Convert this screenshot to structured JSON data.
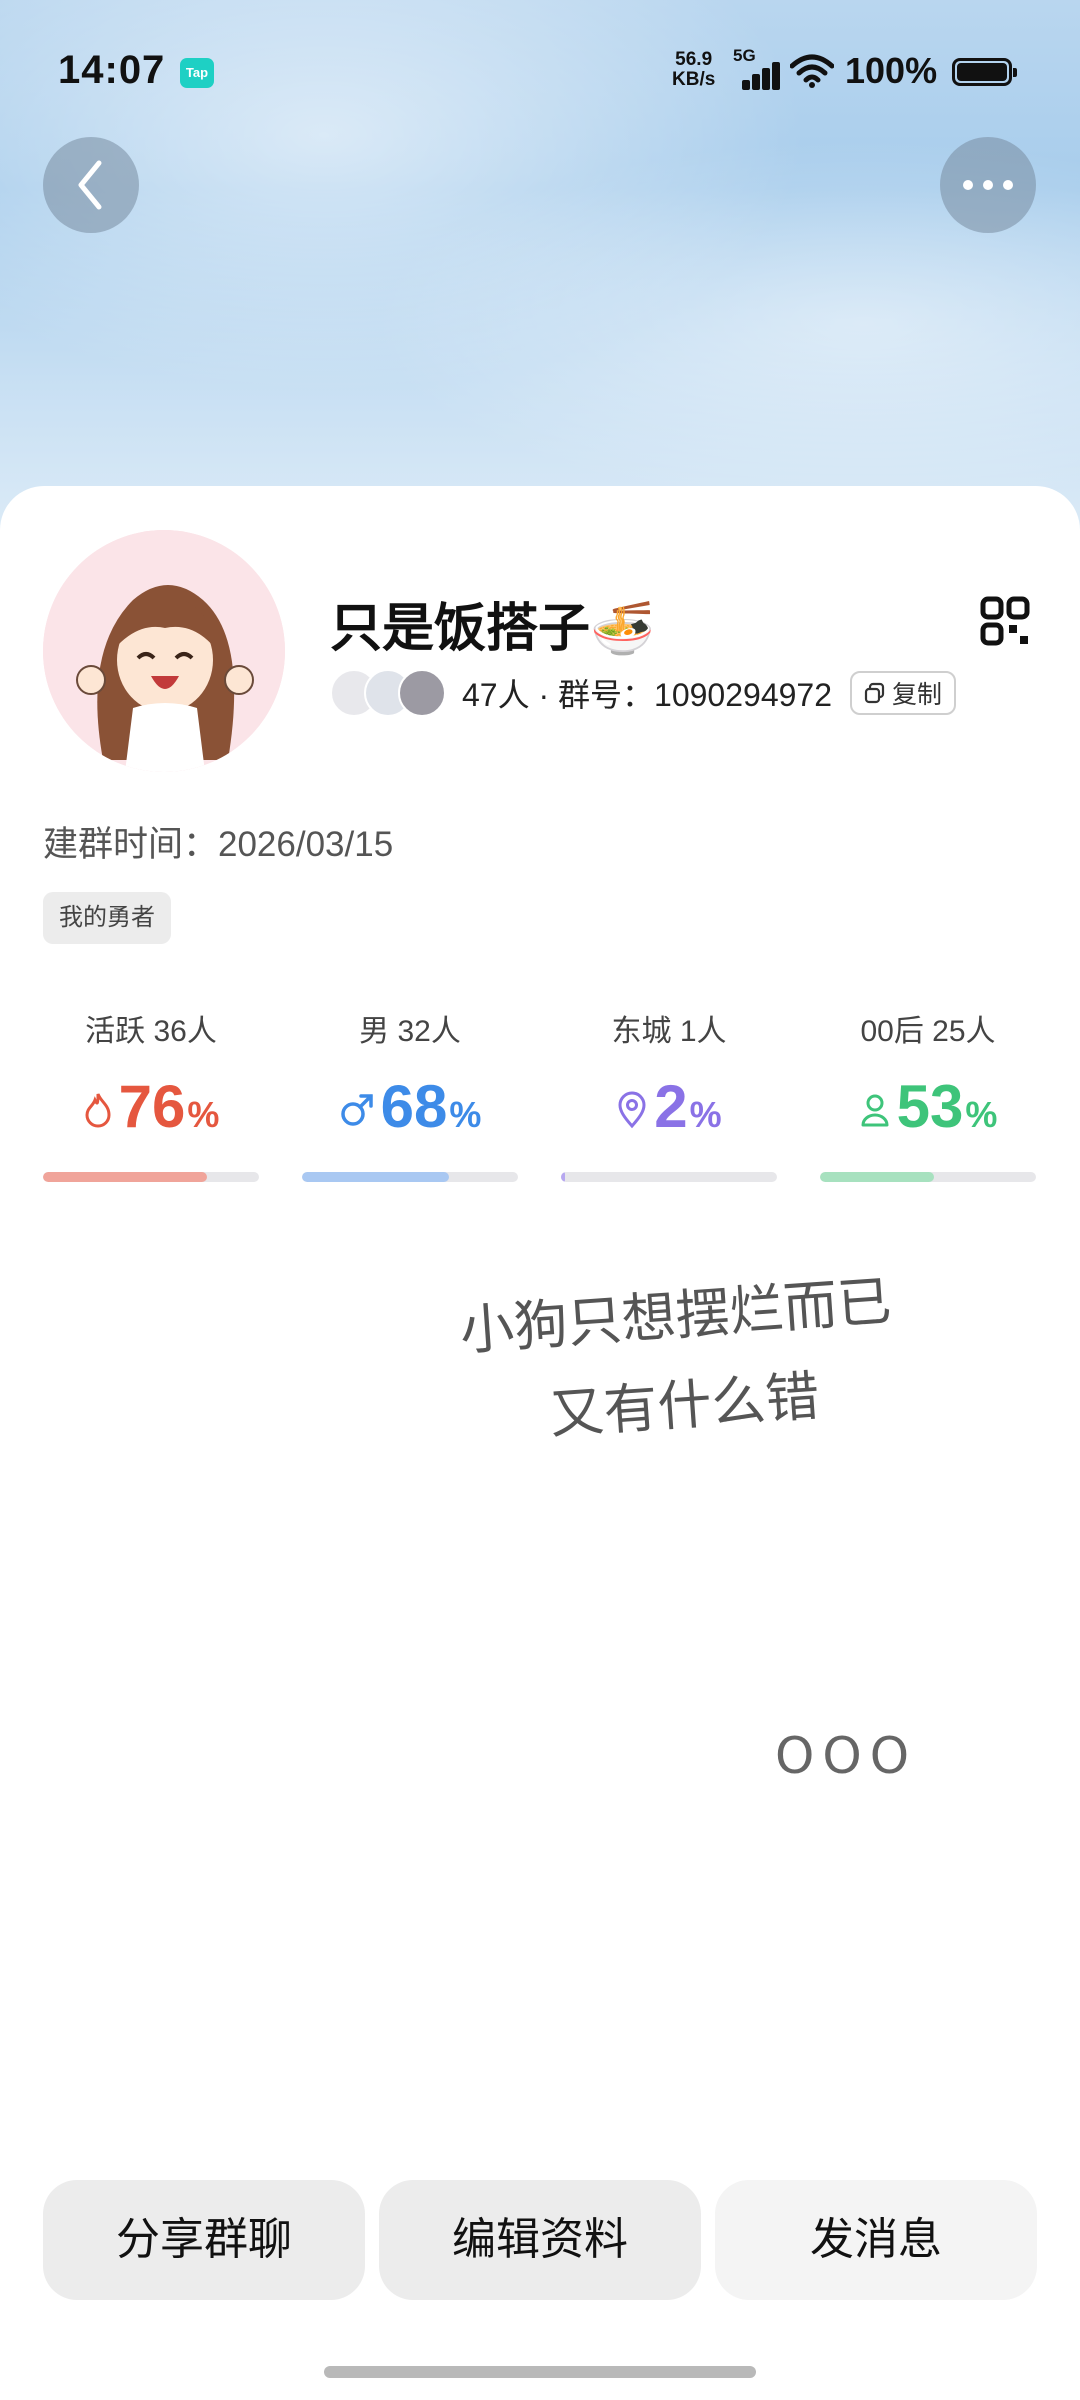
{
  "status_bar": {
    "time": "14:07",
    "app_badge": "Tap",
    "net_speed_value": "56.9",
    "net_speed_unit": "KB/s",
    "network": "5G",
    "battery": "100%"
  },
  "header": {
    "back_icon": "chevron-left-icon",
    "more_icon": "ellipsis-icon"
  },
  "group": {
    "name": "只是饭搭子🍜",
    "member_summary": "47人 · 群号：1090294972",
    "copy_label": "复制",
    "created": "建群时间：2026/03/15",
    "tag": "我的勇者"
  },
  "stats": [
    {
      "label": "活跃 36人",
      "value": "76",
      "unit": "%",
      "fraction": 0.76,
      "icon": "flame-icon",
      "color": "#e5573f",
      "bar_color": "#f0a49a"
    },
    {
      "label": "男 32人",
      "value": "68",
      "unit": "%",
      "fraction": 0.68,
      "icon": "male-icon",
      "color": "#3d8be8",
      "bar_color": "#a9c8f2"
    },
    {
      "label": "东城 1人",
      "value": "2",
      "unit": "%",
      "fraction": 0.02,
      "icon": "location-pin-icon",
      "color": "#8a72e6",
      "bar_color": "#b7a8f0"
    },
    {
      "label": "00后 25人",
      "value": "53",
      "unit": "%",
      "fraction": 0.53,
      "icon": "person-icon",
      "color": "#3ec47a",
      "bar_color": "#a7e1bf"
    }
  ],
  "background_note": {
    "line1": "小狗只想摆烂而已",
    "line2": "又有什么错",
    "line3": "OOO"
  },
  "actions": {
    "share": "分享群聊",
    "edit": "编辑资料",
    "message": "发消息"
  },
  "colors": {
    "banner": "#b9d6ef",
    "button_bg": "#ececec"
  }
}
